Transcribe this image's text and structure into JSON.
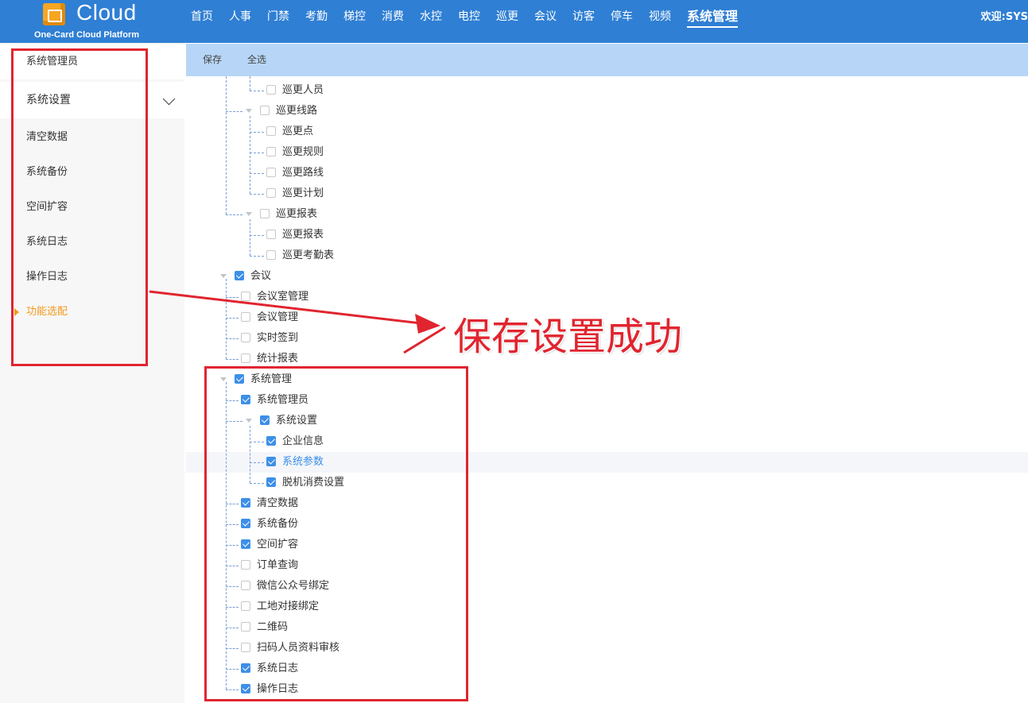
{
  "header": {
    "logo_text": "Cloud",
    "logo_sub": "One-Card Cloud Platform",
    "welcome": "欢迎:SYS",
    "nav": [
      "首页",
      "人事",
      "门禁",
      "考勤",
      "梯控",
      "消费",
      "水控",
      "电控",
      "巡更",
      "会议",
      "访客",
      "停车",
      "视频",
      "系统管理"
    ],
    "active_nav": "系统管理"
  },
  "sidebar": {
    "items": [
      {
        "label": "系统管理员"
      },
      {
        "label": "系统设置"
      },
      {
        "label": "清空数据"
      },
      {
        "label": "系统备份"
      },
      {
        "label": "空间扩容"
      },
      {
        "label": "系统日志"
      },
      {
        "label": "操作日志"
      },
      {
        "label": "功能选配"
      }
    ],
    "active": "功能选配",
    "accent_color": "#f39a1e"
  },
  "toolbar": {
    "save": "保存",
    "select_all": "全选"
  },
  "tree": [
    {
      "label": "巡更人员",
      "checked": false
    },
    {
      "label": "巡更线路",
      "checked": false,
      "expanded": true
    },
    {
      "label": "巡更点",
      "checked": false
    },
    {
      "label": "巡更规则",
      "checked": false
    },
    {
      "label": "巡更路线",
      "checked": false
    },
    {
      "label": "巡更计划",
      "checked": false
    },
    {
      "label": "巡更报表",
      "checked": false,
      "expanded": true
    },
    {
      "label": "巡更报表",
      "checked": false
    },
    {
      "label": "巡更考勤表",
      "checked": false
    },
    {
      "label": "会议",
      "checked": true,
      "expanded": true
    },
    {
      "label": "会议室管理",
      "checked": false
    },
    {
      "label": "会议管理",
      "checked": false
    },
    {
      "label": "实时签到",
      "checked": false
    },
    {
      "label": "统计报表",
      "checked": false
    },
    {
      "label": "系统管理",
      "checked": true,
      "expanded": true
    },
    {
      "label": "系统管理员",
      "checked": true
    },
    {
      "label": "系统设置",
      "checked": true,
      "expanded": true
    },
    {
      "label": "企业信息",
      "checked": true
    },
    {
      "label": "系统参数",
      "checked": true,
      "highlighted": true
    },
    {
      "label": "脱机消费设置",
      "checked": true
    },
    {
      "label": "清空数据",
      "checked": true
    },
    {
      "label": "系统备份",
      "checked": true
    },
    {
      "label": "空间扩容",
      "checked": true
    },
    {
      "label": "订单查询",
      "checked": false
    },
    {
      "label": "微信公众号绑定",
      "checked": false
    },
    {
      "label": "工地对接绑定",
      "checked": false
    },
    {
      "label": "二维码",
      "checked": false
    },
    {
      "label": "扫码人员资料审核",
      "checked": false
    },
    {
      "label": "系统日志",
      "checked": true
    },
    {
      "label": "操作日志",
      "checked": true
    }
  ],
  "annotation": {
    "text": "保存设置成功",
    "color": "#e0252f"
  },
  "colors": {
    "header_bg": "#2f7fd4",
    "toolbar_bg": "#b7d6f7",
    "check_blue": "#3d8fe8"
  }
}
